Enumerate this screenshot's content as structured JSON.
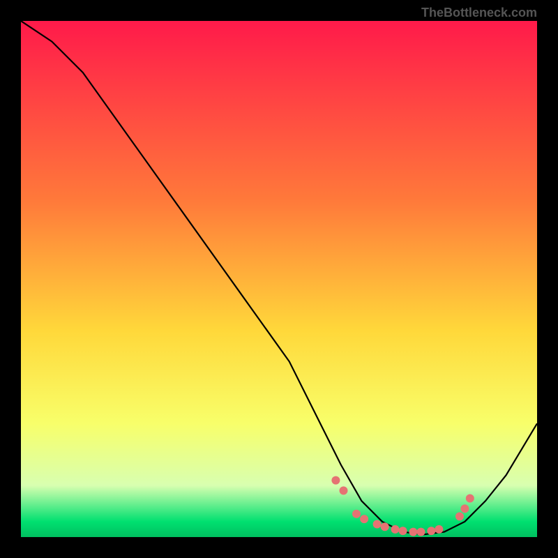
{
  "attribution": "TheBottleneck.com",
  "chart_data": {
    "type": "line",
    "title": "",
    "xlabel": "",
    "ylabel": "",
    "xlim": [
      0,
      100
    ],
    "ylim": [
      0,
      100
    ],
    "gradient_stops": [
      {
        "offset": 0,
        "color": "#ff1a4a"
      },
      {
        "offset": 35,
        "color": "#ff7a3a"
      },
      {
        "offset": 60,
        "color": "#ffd83a"
      },
      {
        "offset": 78,
        "color": "#f8ff6a"
      },
      {
        "offset": 90,
        "color": "#d8ffb0"
      },
      {
        "offset": 97,
        "color": "#00e070"
      },
      {
        "offset": 100,
        "color": "#00c060"
      }
    ],
    "curve": [
      {
        "x": 0,
        "y": 100
      },
      {
        "x": 6,
        "y": 96
      },
      {
        "x": 12,
        "y": 90
      },
      {
        "x": 22,
        "y": 76
      },
      {
        "x": 32,
        "y": 62
      },
      {
        "x": 42,
        "y": 48
      },
      {
        "x": 52,
        "y": 34
      },
      {
        "x": 58,
        "y": 22
      },
      {
        "x": 62,
        "y": 14
      },
      {
        "x": 66,
        "y": 7
      },
      {
        "x": 70,
        "y": 3
      },
      {
        "x": 74,
        "y": 1
      },
      {
        "x": 78,
        "y": 0.5
      },
      {
        "x": 82,
        "y": 1
      },
      {
        "x": 86,
        "y": 3
      },
      {
        "x": 90,
        "y": 7
      },
      {
        "x": 94,
        "y": 12
      },
      {
        "x": 100,
        "y": 22
      }
    ],
    "dots": [
      {
        "x": 61,
        "y": 11
      },
      {
        "x": 62.5,
        "y": 9
      },
      {
        "x": 65,
        "y": 4.5
      },
      {
        "x": 66.5,
        "y": 3.5
      },
      {
        "x": 69,
        "y": 2.5
      },
      {
        "x": 70.5,
        "y": 2
      },
      {
        "x": 72.5,
        "y": 1.5
      },
      {
        "x": 74,
        "y": 1.2
      },
      {
        "x": 76,
        "y": 1
      },
      {
        "x": 77.5,
        "y": 1
      },
      {
        "x": 79.5,
        "y": 1.2
      },
      {
        "x": 81,
        "y": 1.5
      },
      {
        "x": 85,
        "y": 4
      },
      {
        "x": 86,
        "y": 5.5
      },
      {
        "x": 87,
        "y": 7.5
      }
    ],
    "dot_color": "#e57373",
    "curve_color": "#000000"
  }
}
